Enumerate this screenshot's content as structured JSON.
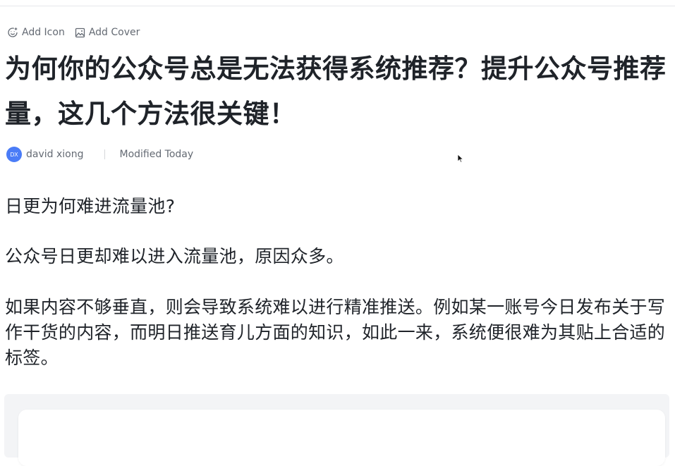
{
  "doc": {
    "add_icon_label": "Add Icon",
    "add_cover_label": "Add Cover",
    "title": "为何你的公众号总是无法获得系统推荐？提升公众号推荐量，这几个方法很关键！",
    "author": {
      "initials": "DX",
      "name": "david xiong"
    },
    "modified": "Modified Today"
  },
  "content": {
    "subheading": "日更为何难进流量池?",
    "paragraph_1": "公众号日更却难以进入流量池，原因众多。",
    "paragraph_2": "如果内容不够垂直，则会导致系统难以进行精准推送。例如某一账号今日发布关于写作干货的内容，而明日推送育儿方面的知识，如此一来，系统便很难为其贴上合适的标签。"
  },
  "colors": {
    "avatar": "#4a7cf7",
    "text": "#1f2329",
    "muted": "#646a73",
    "embed_bg": "#f3f4f6"
  },
  "icons": [
    "smiley-plus-icon",
    "image-icon",
    "mouse-cursor-icon"
  ]
}
